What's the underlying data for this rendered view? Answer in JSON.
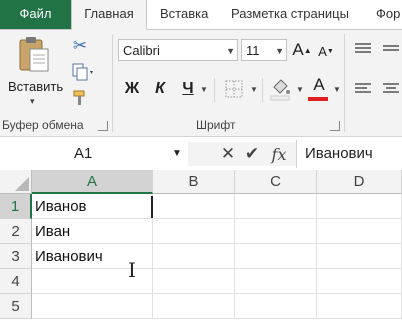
{
  "tabs": {
    "file": "Файл",
    "home": "Главная",
    "insert": "Вставка",
    "page_layout": "Разметка страницы",
    "formulas": "Фор"
  },
  "ribbon": {
    "clipboard": {
      "paste_label": "Вставить",
      "group_label": "Буфер обмена"
    },
    "font": {
      "font_name": "Calibri",
      "font_size": "11",
      "bold": "Ж",
      "italic": "К",
      "underline": "Ч",
      "group_label": "Шрифт",
      "font_color": "#e02020"
    }
  },
  "formula_bar": {
    "name_box": "A1",
    "fx": "fx",
    "content": "Иванович"
  },
  "sheet": {
    "columns": [
      "A",
      "B",
      "C",
      "D"
    ],
    "rows": [
      "1",
      "2",
      "3",
      "4",
      "5"
    ],
    "cells": {
      "A1": "Иванов",
      "A2": "Иван",
      "A3": "Иванович"
    },
    "accent": "#217346"
  }
}
